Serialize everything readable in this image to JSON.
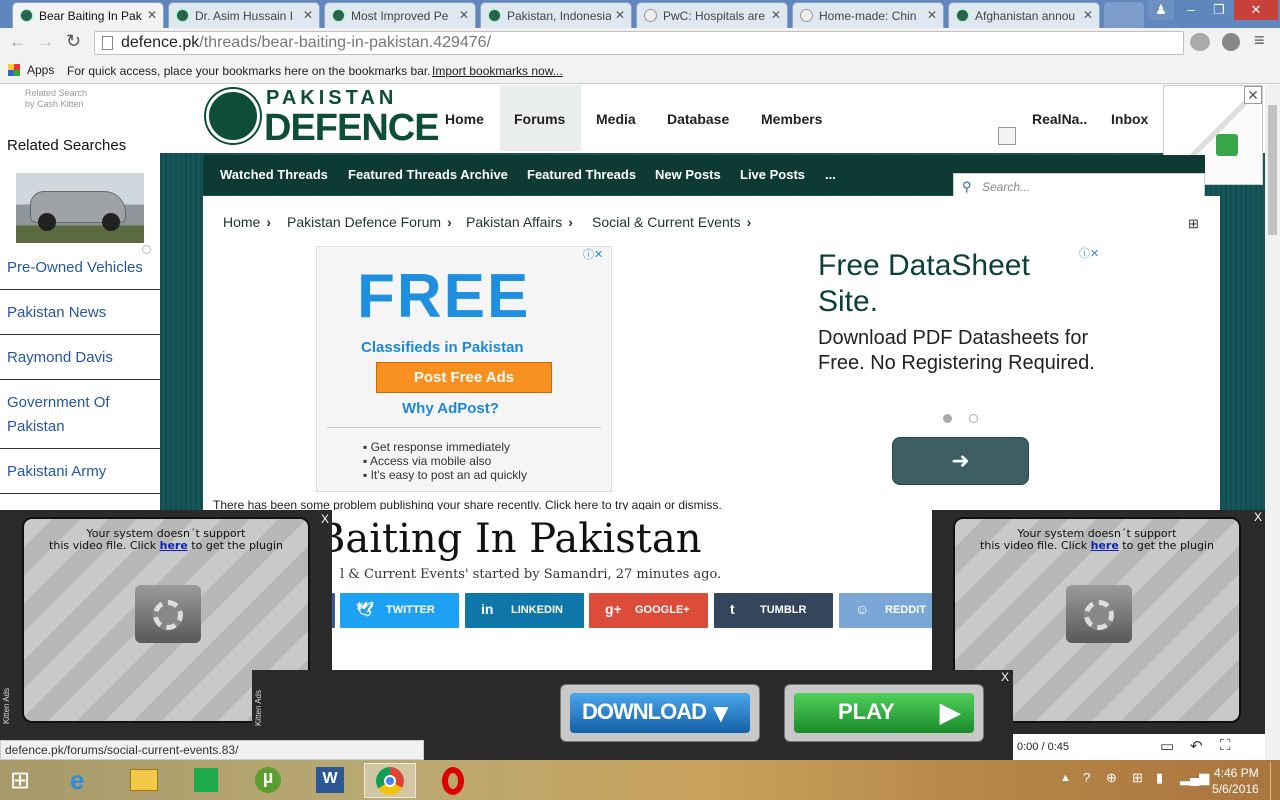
{
  "browser": {
    "tabs": [
      {
        "title": "Bear Baiting In Pak"
      },
      {
        "title": "Dr. Asim Hussain I"
      },
      {
        "title": "Most Improved Pe"
      },
      {
        "title": "Pakistan, Indonesia"
      },
      {
        "title": "PwC: Hospitals are"
      },
      {
        "title": "Home-made: Chin"
      },
      {
        "title": "Afghanistan annou"
      }
    ],
    "url_host": "defence.pk",
    "url_path": "/threads/bear-baiting-in-pakistan.429476/",
    "bookmarks": {
      "apps_label": "Apps",
      "hint": "For quick access, place your bookmarks here on the bookmarks bar.",
      "import_link": "Import bookmarks now..."
    },
    "status_url": "defence.pk/forums/social-current-events.83/"
  },
  "left_sidebar": {
    "related_search_by": "Related Search",
    "by_line": "by Cash Kitten",
    "heading": "Related Searches",
    "items": [
      {
        "label": "Pre-Owned Vehicles"
      },
      {
        "label": "Pakistan News"
      },
      {
        "label": "Raymond Davis"
      },
      {
        "label": "Government Of"
      },
      {
        "label": "Pakistan"
      },
      {
        "label": "Pakistani Army"
      }
    ]
  },
  "site": {
    "logo_top": "PAKISTAN",
    "logo_bottom": "DEFENCE",
    "nav": [
      {
        "label": "Home"
      },
      {
        "label": "Forums"
      },
      {
        "label": "Media"
      },
      {
        "label": "Database"
      },
      {
        "label": "Members"
      }
    ],
    "user": {
      "name": "RealNa..",
      "inbox": "Inbox"
    },
    "subnav": [
      {
        "label": "Watched Threads"
      },
      {
        "label": "Featured Threads Archive"
      },
      {
        "label": "Featured Threads"
      },
      {
        "label": "New Posts"
      },
      {
        "label": "Live Posts"
      },
      {
        "label": "..."
      }
    ],
    "search_placeholder": "Search..."
  },
  "breadcrumb": [
    {
      "label": "Home"
    },
    {
      "label": "Pakistan Defence Forum"
    },
    {
      "label": "Pakistan Affairs"
    },
    {
      "label": "Social & Current Events"
    }
  ],
  "ad_left": {
    "big": "FREE",
    "sub": "Classifieds in Pakistan",
    "button": "Post Free Ads",
    "question": "Why AdPost?",
    "bullets": [
      "Get response immediately",
      "Access via mobile also",
      "It's easy to post an ad quickly"
    ]
  },
  "ad_right": {
    "title": "Free DataSheet Site.",
    "body": "Download PDF Datasheets for Free. No Registering Required.",
    "arrow": "➜"
  },
  "share_notice": "There has been some problem publishing your share recently. Click here to try again or dismiss.",
  "thread": {
    "title": "Baiting In Pakistan",
    "meta": "l & Current Events' started by Samandri, 27 minutes ago."
  },
  "share_buttons": [
    {
      "label": "TWITTER",
      "icon": "twitter-icon",
      "color": "#1da1f2"
    },
    {
      "label": "LINKEDIN",
      "icon": "linkedin-icon",
      "color": "#0e76a8"
    },
    {
      "label": "GOOGLE+",
      "icon": "google-plus-icon",
      "color": "#dd4b39"
    },
    {
      "label": "TUMBLR",
      "icon": "tumblr-icon",
      "color": "#35465c"
    },
    {
      "label": "REDDIT",
      "icon": "reddit-icon",
      "color": "#7aa7d6"
    }
  ],
  "video_popups": {
    "message_line1": "Your system doesn´t support",
    "message_line2a": "this video file. Click",
    "message_link": "here",
    "message_line2b": "to get the plugin",
    "side_label": "Kitten Ads",
    "close": "X",
    "timer": "0:00 / 0:45"
  },
  "bottom_ad": {
    "download_label": "DOWNLOAD",
    "play_label": "PLAY",
    "close": "X",
    "side_label": "Kitten Ads"
  },
  "taskbar": {
    "time": "4:46 PM",
    "date": "5/6/2016"
  }
}
